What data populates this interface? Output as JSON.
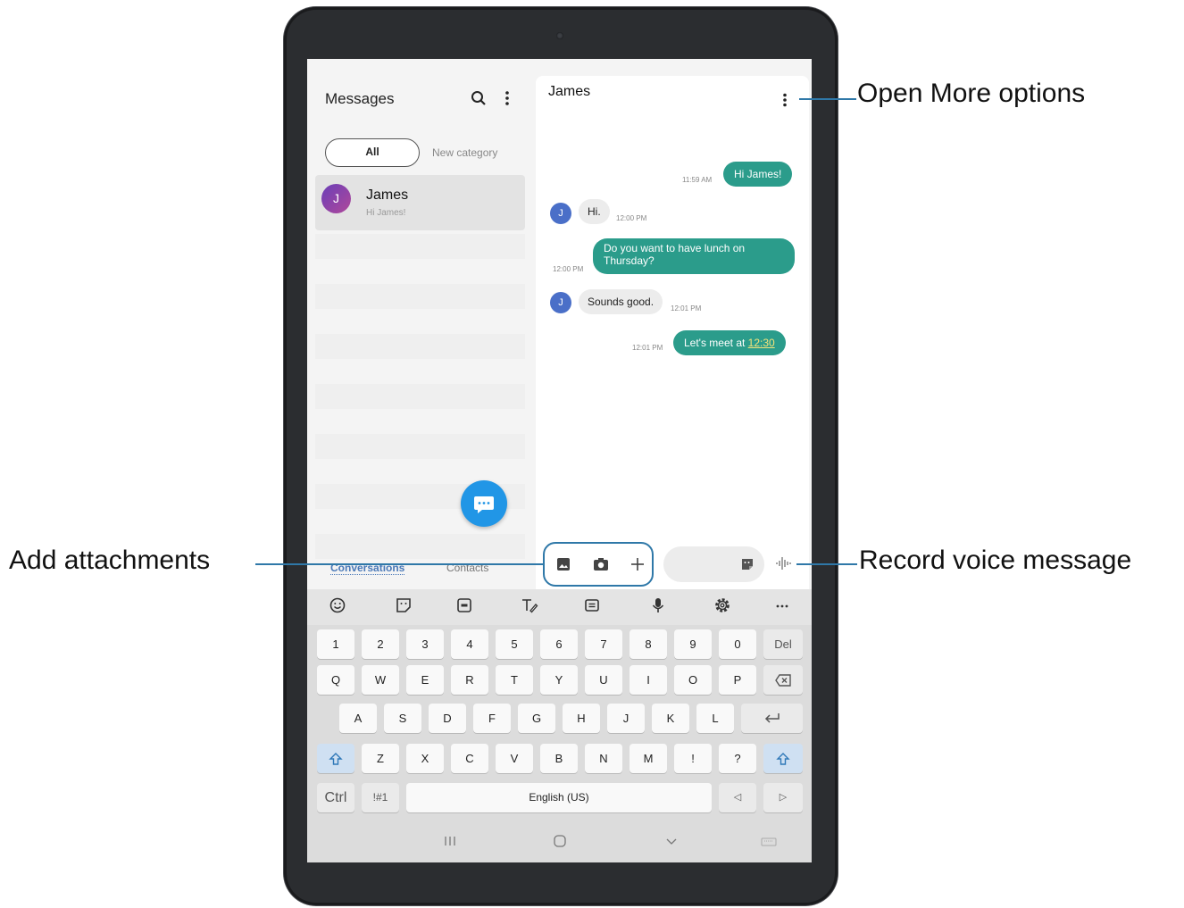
{
  "colors": {
    "accent": "#2b9c8b",
    "fab": "#2196e6",
    "callout_line": "#2f78a8",
    "link_highlight": "#f3e37a"
  },
  "left_pane": {
    "title": "Messages",
    "icons": [
      "search-icon",
      "more-options-icon"
    ],
    "filters": {
      "all": "All",
      "new_category": "New category"
    },
    "conversation": {
      "avatar_initial": "J",
      "name": "James",
      "preview": "Hi James!"
    },
    "fab_icon": "compose-message-icon",
    "bottom_tabs": {
      "conversations": "Conversations",
      "contacts": "Contacts"
    }
  },
  "chat": {
    "contact_name": "James",
    "messages": [
      {
        "direction": "out",
        "text": "Hi James!",
        "time": "11:59 AM"
      },
      {
        "direction": "in",
        "avatar_initial": "J",
        "text": "Hi.",
        "time": "12:00 PM"
      },
      {
        "direction": "out",
        "line1": "Do you want to have lunch on",
        "line2": "Thursday?",
        "time": "12:00 PM"
      },
      {
        "direction": "in",
        "avatar_initial": "J",
        "text": "Sounds good.",
        "time": "12:01 PM"
      },
      {
        "direction": "out",
        "text": "Let's meet at ",
        "link": "12:30",
        "time": "12:01 PM"
      }
    ]
  },
  "compose": {
    "attach_icons": [
      "gallery-icon",
      "camera-icon",
      "plus-icon"
    ],
    "sticker_icon": "sticker-icon",
    "voice_icon": "voice-wave-icon"
  },
  "keyboard": {
    "toolbar": [
      "emoji-icon",
      "sticker-icon",
      "gif-icon",
      "handwriting-icon",
      "clipboard-icon",
      "mic-icon",
      "settings-icon",
      "more-icon"
    ],
    "row1": [
      "1",
      "2",
      "3",
      "4",
      "5",
      "6",
      "7",
      "8",
      "9",
      "0",
      "Del"
    ],
    "row2": [
      "Q",
      "W",
      "E",
      "R",
      "T",
      "Y",
      "U",
      "I",
      "O",
      "P"
    ],
    "row3": [
      "A",
      "S",
      "D",
      "F",
      "G",
      "H",
      "J",
      "K",
      "L"
    ],
    "row4": [
      "Z",
      "X",
      "C",
      "V",
      "B",
      "N",
      "M",
      "!",
      "?"
    ],
    "ctrl": "Ctrl",
    "symbols": "!#1",
    "space": "English (US)",
    "left_arrow": "◁",
    "right_arrow": "▷"
  },
  "nav_bar": [
    "recents-icon",
    "home-icon",
    "back-icon",
    "keyboard-switch-icon"
  ],
  "callouts": {
    "more_options": "Open More options",
    "attachments": "Add attachments",
    "voice": "Record voice message"
  }
}
